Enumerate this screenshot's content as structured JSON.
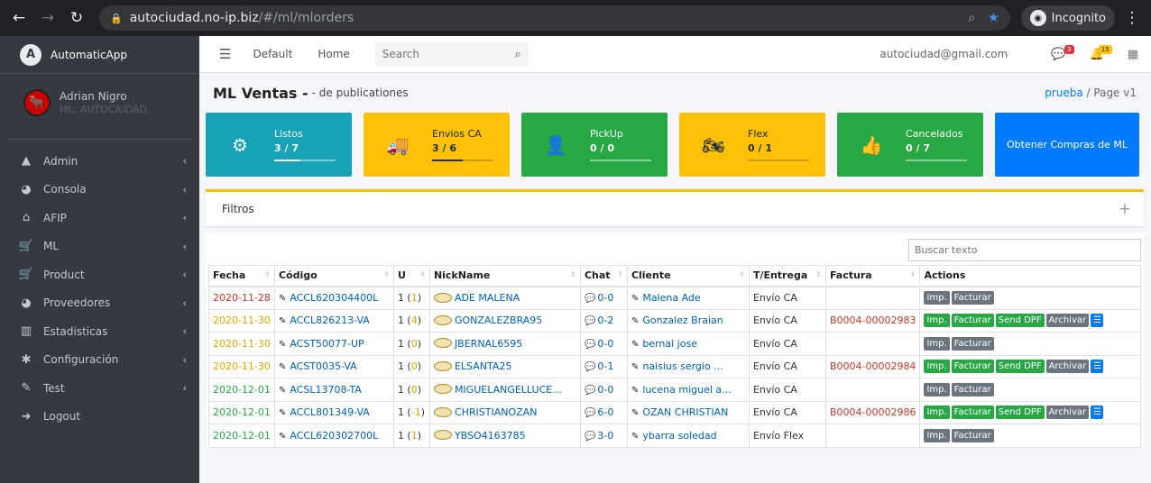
{
  "browser": {
    "host": "autociudad.no-ip.biz",
    "path": "/#/ml/mlorders",
    "incognito": "Incognito"
  },
  "sidebar": {
    "brand": "AutomaticApp",
    "user_name": "Adrian Nigro",
    "user_sub": "ML: AUTOCIUDAD",
    "items": [
      {
        "icon": "warning-icon",
        "glyph": "▲",
        "label": "Admin"
      },
      {
        "icon": "dashboard-icon",
        "glyph": "◕",
        "label": "Consola"
      },
      {
        "icon": "bank-icon",
        "glyph": "⌂",
        "label": "AFIP"
      },
      {
        "icon": "cart-icon",
        "glyph": "🛒",
        "label": "ML"
      },
      {
        "icon": "cart-icon",
        "glyph": "🛒",
        "label": "Product"
      },
      {
        "icon": "dashboard-icon",
        "glyph": "◕",
        "label": "Proveedores"
      },
      {
        "icon": "chart-icon",
        "glyph": "▥",
        "label": "Estadisticas"
      },
      {
        "icon": "gear-icon",
        "glyph": "✱",
        "label": "Configuración"
      },
      {
        "icon": "edit-icon",
        "glyph": "✎",
        "label": "Test"
      },
      {
        "icon": "logout-icon",
        "glyph": "➜",
        "label": "Logout"
      }
    ]
  },
  "topnav": {
    "default": "Default",
    "home": "Home",
    "search_placeholder": "Search",
    "email": "autociudad@gmail.com",
    "msg_badge": "3",
    "notif_badge": "15"
  },
  "header": {
    "title": "ML Ventas -",
    "subtitle": "- de publicationes",
    "crumb_link": "prueba",
    "crumb_current": "Page v1"
  },
  "boxes": [
    {
      "label": "Listos",
      "value": "3 / 7",
      "progress": 0.43,
      "color": "#17a2b8",
      "icon": "gear-icon",
      "glyph": "⚙"
    },
    {
      "label": "Envios CA",
      "value": "3 / 6",
      "progress": 0.5,
      "color": "#ffc107",
      "icon": "truck-icon",
      "glyph": "🚚"
    },
    {
      "label": "PickUp",
      "value": "0 / 0",
      "progress": 0,
      "color": "#28a745",
      "icon": "user-icon",
      "glyph": "👤"
    },
    {
      "label": "Flex",
      "value": "0 / 1",
      "progress": 0,
      "color": "#ffc107",
      "icon": "motorcycle-icon",
      "glyph": "🏍"
    },
    {
      "label": "Cancelados",
      "value": "0 / 7",
      "progress": 0,
      "color": "#28a745",
      "icon": "thumbs-up-icon",
      "glyph": "👍"
    }
  ],
  "obtener": "Obtener Compras de ML",
  "filtros": "Filtros",
  "table": {
    "search_placeholder": "Buscar texto",
    "headers": [
      "Fecha",
      "Código",
      "U",
      "NickName",
      "Chat",
      "Cliente",
      "T/Entrega",
      "Factura",
      "Actions"
    ],
    "rows": [
      {
        "fecha": "2020-11-28",
        "fc": "r",
        "codigo": "ACCL620304400L",
        "u": "1",
        "uc": "1",
        "nick": "ADE MALENA",
        "chat": "0-0",
        "cliente": "Malena Ade",
        "entrega": "Envío CA",
        "factura": "",
        "full": false
      },
      {
        "fecha": "2020-11-30",
        "fc": "y",
        "codigo": "ACCL826213-VA",
        "u": "1",
        "uc": "4",
        "nick": "GONZALEZBRA95",
        "chat": "0-2",
        "cliente": "Gonzalez Braian",
        "entrega": "Envío CA",
        "factura": "B0004-00002983",
        "full": true
      },
      {
        "fecha": "2020-11-30",
        "fc": "y",
        "codigo": "ACST50077-UP",
        "u": "1",
        "uc": "0",
        "nick": "JBERNAL6595",
        "chat": "0-0",
        "cliente": "bernal jose",
        "entrega": "Envío CA",
        "factura": "",
        "full": false
      },
      {
        "fecha": "2020-11-30",
        "fc": "y",
        "codigo": "ACST0035-VA",
        "u": "1",
        "uc": "0",
        "nick": "ELSANTA25",
        "chat": "0-1",
        "cliente": "naisius sergio ...",
        "entrega": "Envío CA",
        "factura": "B0004-00002984",
        "full": true
      },
      {
        "fecha": "2020-12-01",
        "fc": "g",
        "codigo": "ACSL13708-TA",
        "u": "1",
        "uc": "0",
        "nick": "MIGUELANGELLUCE...",
        "chat": "0-0",
        "cliente": "lucena miguel a...",
        "entrega": "Envío CA",
        "factura": "",
        "full": false
      },
      {
        "fecha": "2020-12-01",
        "fc": "g",
        "codigo": "ACCL801349-VA",
        "u": "1",
        "uc": "-1",
        "nick": "CHRISTIANOZAN",
        "chat": "6-0",
        "cliente": "OZAN CHRISTIAN",
        "entrega": "Envío CA",
        "factura": "B0004-00002986",
        "full": true
      },
      {
        "fecha": "2020-12-01",
        "fc": "g",
        "codigo": "ACCL620302700L",
        "u": "1",
        "uc": "1",
        "nick": "YBSO4163785",
        "chat": "3-0",
        "cliente": "ybarra soledad",
        "entrega": "Envío Flex",
        "factura": "",
        "full": false
      }
    ],
    "btn": {
      "imp": "Imp.",
      "facturar": "Facturar",
      "send": "Send DPF",
      "archivar": "Archivar"
    }
  }
}
